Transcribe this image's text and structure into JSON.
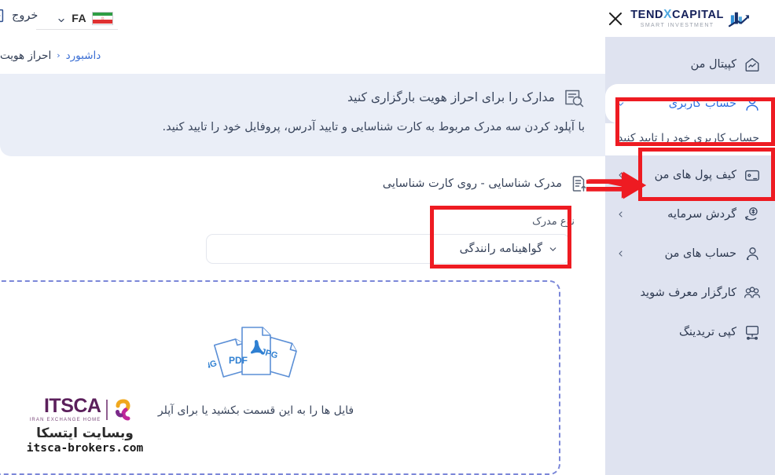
{
  "brand": {
    "name_part1": "CAPITAL",
    "name_x": "X",
    "name_part2": "TEND",
    "tagline": "SMART INVESTMENT",
    "logo_icon": "bar-chart-arrow-logo",
    "close_icon": "close-icon",
    "color_navy": "#14205a",
    "color_x_blue": "#4fa8e0"
  },
  "topbar": {
    "language": {
      "code": "FA",
      "flag_icon": "iran-flag-icon",
      "chevron_icon": "chevron-down-icon"
    },
    "exit": {
      "label": "خروج",
      "icon": "logout-icon"
    }
  },
  "breadcrumb": {
    "items": [
      {
        "label": "داشبورد",
        "current": false
      },
      {
        "label": "احراز هویت",
        "current": true
      }
    ],
    "separator": "‹"
  },
  "sidebar": {
    "items": [
      {
        "label": "کپیتال من",
        "icon": "home-chart-icon",
        "chevron": false,
        "active": false
      },
      {
        "label": "حساب کاربری",
        "icon": "user-icon",
        "chevron": true,
        "active": true
      },
      {
        "label": "کیف پول های من",
        "icon": "wallet-icon",
        "chevron": true,
        "active": false
      },
      {
        "label": "گردش سرمایه",
        "icon": "money-flow-icon",
        "chevron": true,
        "active": false
      },
      {
        "label": "حساب های من",
        "icon": "user-accounts-icon",
        "chevron": true,
        "active": false
      },
      {
        "label": "کارگزار معرف شوید",
        "icon": "people-group-icon",
        "chevron": false,
        "active": false
      },
      {
        "label": "کپی تریدینگ",
        "icon": "copy-trading-icon",
        "chevron": false,
        "active": false
      }
    ],
    "submenu_item": {
      "label": "حساب کاربری خود را تایید کنید"
    },
    "bg_color": "#dfe3f0",
    "active_color": "#2f6fe0"
  },
  "header_card": {
    "title": "مدارک را برای احراز هویت بارگزاری کنید",
    "icon": "document-search-icon",
    "subtitle": "با آپلود کردن سه مدرک مربوط به کارت شناسایی و تایید آدرس، پروفایل خود را تایید کنید.",
    "bg_color": "#eaeef7"
  },
  "section": {
    "title": "مدرک شناسایی - روی کارت شناسایی",
    "icon": "document-upload-icon",
    "field_label": "نوع مدرک",
    "select": {
      "value": "گواهینامه رانندگی",
      "chevron_icon": "chevron-down-icon"
    }
  },
  "dropzone": {
    "text": "فایل ها را به این قسمت بکشید یا برای آپلر",
    "file_types": [
      "PNG",
      "PDF",
      "JPG"
    ],
    "border_color": "#7b87d8"
  },
  "annotations": {
    "color": "#ee1b22",
    "boxes": [
      {
        "name": "highlight-account-nav"
      },
      {
        "name": "highlight-verify-submenu"
      },
      {
        "name": "highlight-doc-type-select"
      }
    ],
    "arrow": {
      "name": "pointer-arrow",
      "direction": "right"
    }
  },
  "watermark": {
    "name": "ITSCA",
    "tagline": "IRAN EXCHANGE HOME",
    "farsi": "وبسایت ایتسکا",
    "url": "itsca-brokers.com"
  }
}
